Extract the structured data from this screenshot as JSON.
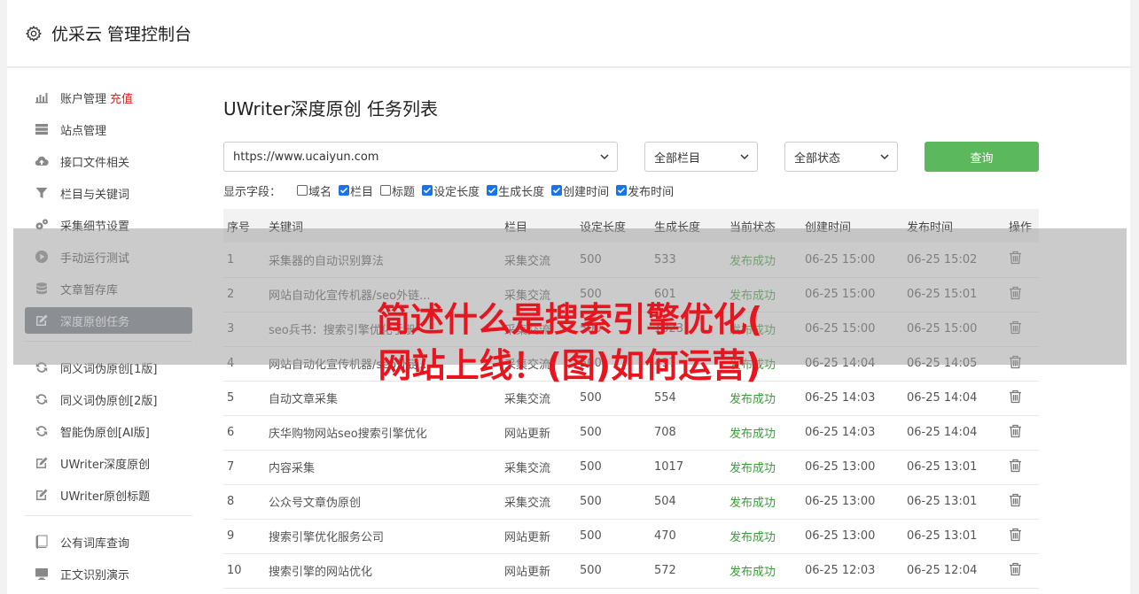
{
  "header": {
    "title": "优采云 管理控制台"
  },
  "sidebar": {
    "group1": [
      {
        "label": "账户管理",
        "extra": "充值",
        "icon": "bar-chart-icon"
      },
      {
        "label": "站点管理",
        "icon": "server-icon"
      },
      {
        "label": "接口文件相关",
        "icon": "cloud-upload-icon"
      },
      {
        "label": "栏目与关键词",
        "icon": "filter-icon"
      },
      {
        "label": "采集细节设置",
        "icon": "cogs-icon"
      },
      {
        "label": "手动运行测试",
        "icon": "play-circle-icon"
      },
      {
        "label": "文章暂存库",
        "icon": "database-icon"
      },
      {
        "label": "深度原创任务",
        "icon": "edit-icon",
        "active": true
      }
    ],
    "group2": [
      {
        "label": "同义词伪原创[1版]",
        "icon": "refresh-icon"
      },
      {
        "label": "同义词伪原创[2版]",
        "icon": "refresh-icon"
      },
      {
        "label": "智能伪原创[AI版]",
        "icon": "refresh-icon"
      },
      {
        "label": "UWriter深度原创",
        "icon": "edit-icon"
      },
      {
        "label": "UWriter原创标题",
        "icon": "edit-icon"
      }
    ],
    "group3": [
      {
        "label": "公有词库查询",
        "icon": "book-icon"
      },
      {
        "label": "正文识别演示",
        "icon": "monitor-icon"
      }
    ]
  },
  "main": {
    "title": "UWriter深度原创 任务列表",
    "site_select": "https://www.ucaiyun.com",
    "column_select": "全部栏目",
    "status_select": "全部状态",
    "query_label": "查询",
    "fields_label": "显示字段：",
    "fields": [
      {
        "label": "域名",
        "checked": false
      },
      {
        "label": "栏目",
        "checked": true
      },
      {
        "label": "标题",
        "checked": false
      },
      {
        "label": "设定长度",
        "checked": true
      },
      {
        "label": "生成长度",
        "checked": true
      },
      {
        "label": "创建时间",
        "checked": true
      },
      {
        "label": "发布时间",
        "checked": true
      }
    ]
  },
  "table": {
    "headers": [
      "序号",
      "关键词",
      "栏目",
      "设定长度",
      "生成长度",
      "当前状态",
      "创建时间",
      "发布时间",
      "操作"
    ],
    "rows": [
      [
        "1",
        "采集器的自动识别算法",
        "采集交流",
        "500",
        "533",
        "发布成功",
        "06-25 15:00",
        "06-25 15:02"
      ],
      [
        "2",
        "网站自动化宣传机器/seo外链...",
        "采集交流",
        "500",
        "601",
        "发布成功",
        "06-25 15:00",
        "06-25 15:01"
      ],
      [
        "3",
        "seo兵书：搜索引擎优化手册",
        "采集交流",
        "500",
        "1023",
        "发布成功",
        "06-25 15:00",
        "06-25 15:00"
      ],
      [
        "4",
        "网站自动化宣传机器/seo外链...",
        "采集交流",
        "500",
        "497",
        "发布成功",
        "06-25 14:04",
        "06-25 14:05"
      ],
      [
        "5",
        "自动文章采集",
        "采集交流",
        "500",
        "554",
        "发布成功",
        "06-25 14:03",
        "06-25 14:04"
      ],
      [
        "6",
        "庆华购物网站seo搜索引擎优化",
        "网站更新",
        "500",
        "708",
        "发布成功",
        "06-25 14:03",
        "06-25 14:04"
      ],
      [
        "7",
        "内容采集",
        "采集交流",
        "500",
        "1017",
        "发布成功",
        "06-25 13:00",
        "06-25 13:01"
      ],
      [
        "8",
        "公众号文章伪原创",
        "采集交流",
        "500",
        "504",
        "发布成功",
        "06-25 13:00",
        "06-25 13:01"
      ],
      [
        "9",
        "搜索引擎优化服务公司",
        "网站更新",
        "500",
        "470",
        "发布成功",
        "06-25 13:00",
        "06-25 13:01"
      ],
      [
        "10",
        "搜索引擎的网站优化",
        "网站更新",
        "500",
        "572",
        "发布成功",
        "06-25 12:03",
        "06-25 12:04"
      ]
    ]
  },
  "overlay": {
    "line1": "简述什么是搜索引擎优化(",
    "line2": "网站上线！(图)如何运营)"
  }
}
